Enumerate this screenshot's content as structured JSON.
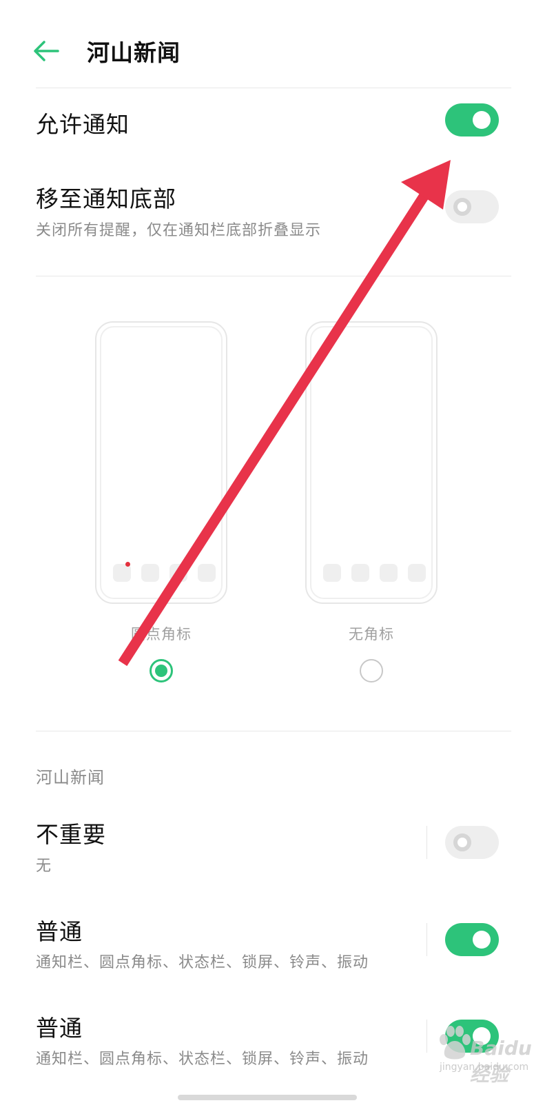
{
  "header": {
    "title": "河山新闻",
    "back_icon": "arrow-left-icon"
  },
  "allow_notifications": {
    "label": "允许通知",
    "enabled": true
  },
  "move_to_bottom": {
    "label": "移至通知底部",
    "description": "关闭所有提醒，仅在通知栏底部折叠显示",
    "enabled": false
  },
  "badge_style": {
    "options": [
      {
        "label": "圆点角标",
        "selected": true
      },
      {
        "label": "无角标",
        "selected": false
      }
    ]
  },
  "channels": {
    "section_label": "河山新闻",
    "items": [
      {
        "title": "不重要",
        "description": "无",
        "enabled": false
      },
      {
        "title": "普通",
        "description": "通知栏、圆点角标、状态栏、锁屏、铃声、振动",
        "enabled": true
      },
      {
        "title": "普通",
        "description": "通知栏、圆点角标、状态栏、锁屏、铃声、振动",
        "enabled": true
      }
    ]
  },
  "watermark": {
    "brand": "Baidu 经验",
    "url": "jingyan.baidu.com"
  },
  "colors": {
    "accent": "#2dc37a",
    "arrow": "#e8334a",
    "badge": "#e3303d"
  }
}
